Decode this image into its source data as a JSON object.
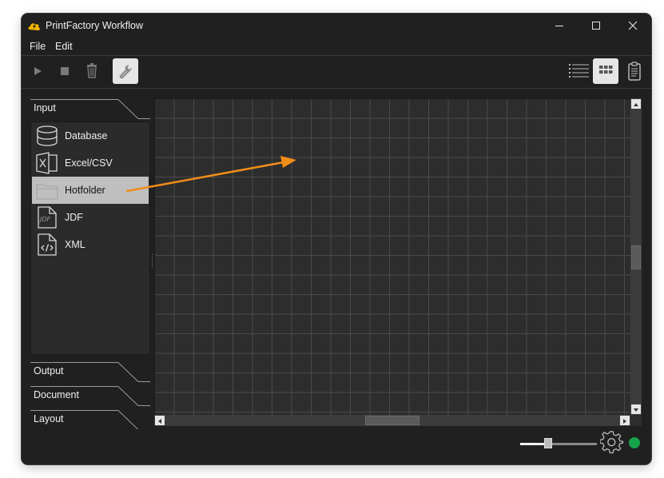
{
  "window": {
    "title": "PrintFactory Workflow"
  },
  "menu": {
    "file": "File",
    "edit": "Edit"
  },
  "sidebar": {
    "sections": [
      {
        "label": "Input"
      },
      {
        "label": "Output"
      },
      {
        "label": "Document"
      },
      {
        "label": "Layout"
      }
    ],
    "input_items": [
      {
        "label": "Database",
        "icon": "database-icon"
      },
      {
        "label": "Excel/CSV",
        "icon": "excel-icon"
      },
      {
        "label": "Hotfolder",
        "icon": "folder-icon",
        "selected": true
      },
      {
        "label": "JDF",
        "icon": "jdf-file-icon"
      },
      {
        "label": "XML",
        "icon": "xml-file-icon"
      }
    ]
  },
  "status": {
    "zoom_fraction": 0.36,
    "connection_color": "#16a34a"
  },
  "colors": {
    "accent_arrow": "#f28c18",
    "app_icon": "#f5b400"
  }
}
